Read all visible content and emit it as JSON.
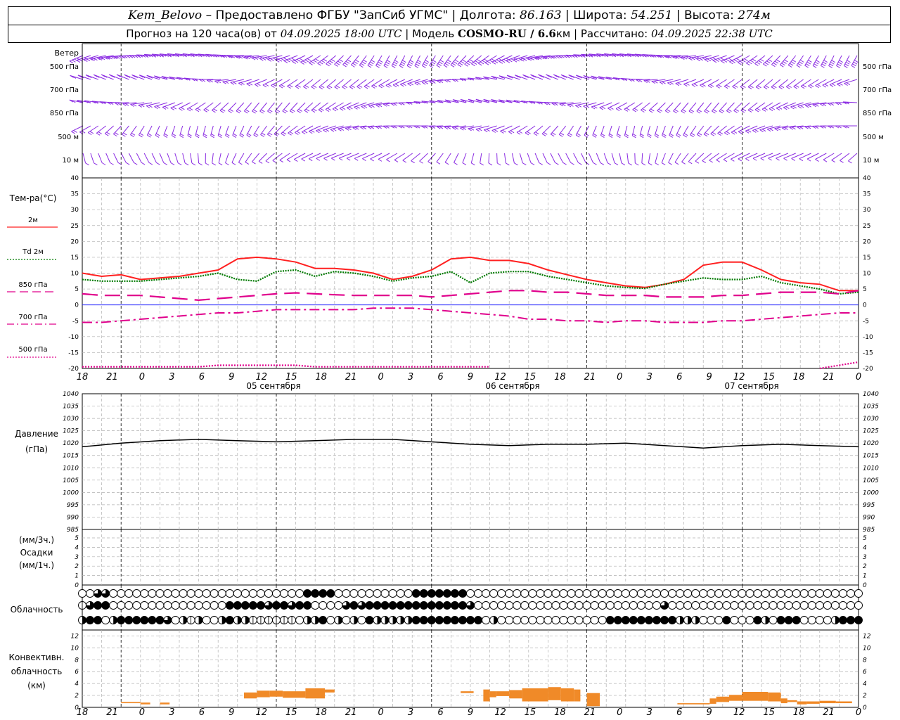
{
  "header": {
    "station": "Kem_Belovo",
    "provider": "– Предоставлено ФГБУ \"ЗапСиб УГМС\"",
    "lon_label": "Долгота:",
    "lon": "86.163",
    "lat_label": "Широта:",
    "lat": "54.251",
    "alt_label": "Высота:",
    "alt": "274м",
    "forecast_label": "Прогноз на 120 часа(ов) от",
    "forecast_time": "04.09.2025 18:00 UTC",
    "model_label": "Модель",
    "model": "COSMO-RU / 6.6",
    "model_unit": "км",
    "calc_label": "Рассчитано:",
    "calc_time": "04.09.2025 22:38 UTC"
  },
  "wind_panel": {
    "title": "Ветер",
    "levels": [
      "500 гПа",
      "700 гПа",
      "850 гПа",
      "500 м",
      "10 м"
    ]
  },
  "time_axis": {
    "hour_labels": [
      "18",
      "21",
      "0",
      "3",
      "6",
      "9",
      "12",
      "15",
      "18",
      "21",
      "0",
      "3",
      "6",
      "9",
      "12",
      "15",
      "18",
      "21",
      "0",
      "3",
      "6",
      "9",
      "12",
      "15",
      "18",
      "21",
      "0"
    ],
    "day_labels": [
      "05 сентября",
      "06 сентября",
      "07 сентября"
    ]
  },
  "temperature_panel": {
    "title": "Тем-ра(°С)",
    "legend": [
      {
        "label": "2м",
        "color": "#ff2020",
        "style": "solid"
      },
      {
        "label": "Td  2м",
        "color": "#007a00",
        "style": "dotted"
      },
      {
        "label": "850 гПа",
        "color": "#e0008c",
        "style": "dashed"
      },
      {
        "label": "700 гПа",
        "color": "#e0008c",
        "style": "dashdot"
      },
      {
        "label": "500 гПа",
        "color": "#e0008c",
        "style": "dotted"
      }
    ],
    "y_ticks": [
      "40",
      "35",
      "30",
      "25",
      "20",
      "15",
      "10",
      "5",
      "0",
      "-5",
      "-10",
      "-15",
      "-20"
    ]
  },
  "pressure_panel": {
    "title": "Давление",
    "unit": "(гПа)",
    "y_ticks": [
      "1040",
      "1035",
      "1030",
      "1025",
      "1020",
      "1015",
      "1010",
      "1005",
      "1000",
      "995",
      "990",
      "985"
    ]
  },
  "precip_panel": {
    "unit3": "(мм/3ч.)",
    "title": "Осадки",
    "unit1": "(мм/1ч.)",
    "y_ticks": [
      "5",
      "4",
      "3",
      "2",
      "1",
      "0"
    ]
  },
  "cloud_panel": {
    "title": "Облачность"
  },
  "conv_panel": {
    "title_1": "Конвективн.",
    "title_2": "облачность",
    "title_3": "(км)",
    "y_ticks": [
      "12",
      "10",
      "8",
      "6",
      "4",
      "2",
      "0"
    ]
  },
  "chart_data": [
    {
      "type": "line",
      "title": "Тем-ра(°С)",
      "x_hours_from_start": [
        0,
        3,
        6,
        9,
        12,
        15,
        18,
        21,
        24,
        27,
        30,
        33,
        36,
        39,
        42,
        45,
        48,
        51,
        54,
        57,
        60,
        63,
        66,
        69,
        72,
        75,
        78,
        81,
        84,
        87,
        90,
        93,
        96,
        99,
        102,
        105,
        108,
        111,
        114,
        117,
        120
      ],
      "ylim": [
        -20,
        40
      ],
      "series": [
        {
          "name": "2м",
          "values": [
            10,
            9,
            9.5,
            8,
            8.5,
            9,
            10,
            11,
            14.5,
            15,
            14.5,
            13.5,
            11.5,
            11.5,
            11,
            10,
            8,
            9,
            11,
            14.5,
            15,
            14,
            14,
            13,
            11,
            9.5,
            8,
            7,
            6,
            5.5,
            6.5,
            8,
            12.5,
            13.5,
            13.5,
            11,
            8,
            7,
            6.5,
            4.5,
            4.5
          ]
        },
        {
          "name": "Td  2м",
          "values": [
            8,
            7.5,
            7.5,
            7.5,
            8,
            8.5,
            9,
            10,
            8,
            7.5,
            10.5,
            11,
            9,
            10.5,
            10,
            9,
            7.5,
            8.5,
            9,
            10.5,
            7,
            10,
            10.5,
            10.5,
            9,
            8,
            7,
            6,
            5.5,
            5.2,
            6.5,
            7.5,
            8.5,
            8,
            8,
            9,
            7,
            6,
            5,
            3.5,
            4
          ]
        },
        {
          "name": "850 гПа",
          "values": [
            3.5,
            3,
            3,
            3,
            2.5,
            2,
            1.5,
            2,
            2.5,
            3,
            3.5,
            3.8,
            3.5,
            3.2,
            3,
            3,
            3,
            3,
            2.5,
            3,
            3.5,
            4,
            4.5,
            4.5,
            4,
            4,
            3.5,
            3,
            3,
            3,
            2.5,
            2.5,
            2.5,
            3,
            3,
            3.5,
            4,
            4,
            4,
            3.5,
            4.5
          ]
        },
        {
          "name": "700 гПа",
          "values": [
            -5.5,
            -5.5,
            -5,
            -4.5,
            -4,
            -3.5,
            -3,
            -2.5,
            -2.5,
            -2,
            -1.5,
            -1.5,
            -1.5,
            -1.5,
            -1.5,
            -1,
            -1,
            -1,
            -1.5,
            -2,
            -2.5,
            -3,
            -3.5,
            -4.5,
            -4.5,
            -5,
            -5,
            -5.5,
            -5,
            -5,
            -5.5,
            -5.5,
            -5.5,
            -5,
            -5,
            -4.5,
            -4,
            -3.5,
            -3,
            -2.5,
            -2.5
          ]
        },
        {
          "name": "500 гПа",
          "values": [
            -19.5,
            -19.5,
            -19.5,
            -19.5,
            -19.5,
            -19.5,
            -19.5,
            -19,
            -19,
            -19,
            -19,
            -19,
            -19.5,
            -19.5,
            -19.5,
            -19.5,
            -19.5,
            -19.5,
            -19.5,
            -19.5,
            -19.5,
            -19.5,
            -20.5,
            -21,
            -21,
            -21.5,
            -21.5,
            -21.5,
            -21.5,
            -21.5,
            -21.5,
            -21.5,
            -21.5,
            -21.5,
            -21.5,
            -21.5,
            -21.5,
            -21,
            -20,
            -19,
            -18
          ]
        }
      ]
    },
    {
      "type": "line",
      "title": "Давление",
      "ylabel": "(гПа)",
      "ylim": [
        985,
        1040
      ],
      "x_hours_from_start": [
        0,
        6,
        12,
        18,
        24,
        30,
        36,
        42,
        48,
        54,
        60,
        66,
        72,
        78,
        84,
        90,
        96,
        102,
        108,
        114,
        120
      ],
      "values": [
        1018.5,
        1020,
        1021,
        1021.5,
        1021,
        1020.5,
        1021,
        1021.5,
        1021.5,
        1020.5,
        1019.5,
        1019,
        1019.5,
        1019.5,
        1020,
        1019,
        1018,
        1019,
        1019.5,
        1019,
        1018.5
      ]
    },
    {
      "type": "bar",
      "title": "Конвективн. облачность (км)",
      "ylim": [
        0,
        13
      ],
      "segments": [
        {
          "from": 6.0,
          "to": 7.5,
          "bottom": 0.7,
          "top": 0.9
        },
        {
          "from": 7.5,
          "to": 9.0,
          "bottom": 0.7,
          "top": 0.9
        },
        {
          "from": 9.0,
          "to": 10.5,
          "bottom": 0.5,
          "top": 0.8
        },
        {
          "from": 12.0,
          "to": 13.5,
          "bottom": 0.5,
          "top": 0.8
        },
        {
          "from": 25.0,
          "to": 27.0,
          "bottom": 1.5,
          "top": 2.5
        },
        {
          "from": 27.0,
          "to": 29.0,
          "bottom": 1.7,
          "top": 2.8
        },
        {
          "from": 29.0,
          "to": 31.0,
          "bottom": 1.8,
          "top": 2.8
        },
        {
          "from": 31.0,
          "to": 34.5,
          "bottom": 1.6,
          "top": 2.7
        },
        {
          "from": 34.5,
          "to": 37.5,
          "bottom": 1.5,
          "top": 3.2
        },
        {
          "from": 37.5,
          "to": 39.0,
          "bottom": 2.5,
          "top": 3.0
        },
        {
          "from": 58.5,
          "to": 60.5,
          "bottom": 2.4,
          "top": 2.7
        },
        {
          "from": 62.0,
          "to": 63.0,
          "bottom": 1.0,
          "top": 3.0
        },
        {
          "from": 63.0,
          "to": 64.0,
          "bottom": 1.7,
          "top": 2.7
        },
        {
          "from": 64.0,
          "to": 66.0,
          "bottom": 1.9,
          "top": 2.7
        },
        {
          "from": 66.0,
          "to": 68.0,
          "bottom": 1.5,
          "top": 2.9
        },
        {
          "from": 68.0,
          "to": 72.0,
          "bottom": 1.0,
          "top": 3.2
        },
        {
          "from": 72.0,
          "to": 74.0,
          "bottom": 1.2,
          "top": 3.4
        },
        {
          "from": 74.0,
          "to": 76.0,
          "bottom": 1.0,
          "top": 3.2
        },
        {
          "from": 76.0,
          "to": 77.0,
          "bottom": 1.0,
          "top": 3.0
        },
        {
          "from": 78.0,
          "to": 80.0,
          "bottom": 0.2,
          "top": 2.4
        },
        {
          "from": 92.0,
          "to": 97.0,
          "bottom": 0.5,
          "top": 0.7
        },
        {
          "from": 97.0,
          "to": 98.0,
          "bottom": 0.6,
          "top": 1.5
        },
        {
          "from": 98.0,
          "to": 100.0,
          "bottom": 0.9,
          "top": 1.8
        },
        {
          "from": 100.0,
          "to": 102.0,
          "bottom": 1.1,
          "top": 2.1
        },
        {
          "from": 102.0,
          "to": 106.0,
          "bottom": 1.1,
          "top": 2.6
        },
        {
          "from": 106.0,
          "to": 108.0,
          "bottom": 1.0,
          "top": 2.5
        },
        {
          "from": 108.0,
          "to": 109.0,
          "bottom": 0.7,
          "top": 1.5
        },
        {
          "from": 109.0,
          "to": 110.5,
          "bottom": 0.9,
          "top": 1.2
        },
        {
          "from": 110.5,
          "to": 112.0,
          "bottom": 0.5,
          "top": 1.0
        },
        {
          "from": 112.0,
          "to": 114.0,
          "bottom": 0.6,
          "top": 1.0
        },
        {
          "from": 114.0,
          "to": 116.5,
          "bottom": 0.7,
          "top": 1.1
        },
        {
          "from": 116.5,
          "to": 119.0,
          "bottom": 0.7,
          "top": 1.0
        },
        {
          "from": 129.0,
          "to": 130.5,
          "bottom": 0.6,
          "top": 0.9
        }
      ]
    }
  ],
  "clouds": {
    "rows": [
      "00330000000000000000000000000444400000000004444444000000000000000000000000000000000000000000000000000",
      "13440000000000000004444434434400003434444444444444300000000000000000000000030000000000000000000000000",
      "24402444444302120024221111110224020204222224444444440200000000000000444444444222000400042044400002444"
    ]
  },
  "colors": {
    "wind": "#8a2be2",
    "t2m": "#ff2020",
    "td2m": "#007a00",
    "upper": "#e0008c",
    "zero_line": "#2020ff",
    "pressure": "#000000",
    "conv": "#f08a28",
    "grid": "#b0b0b0"
  }
}
